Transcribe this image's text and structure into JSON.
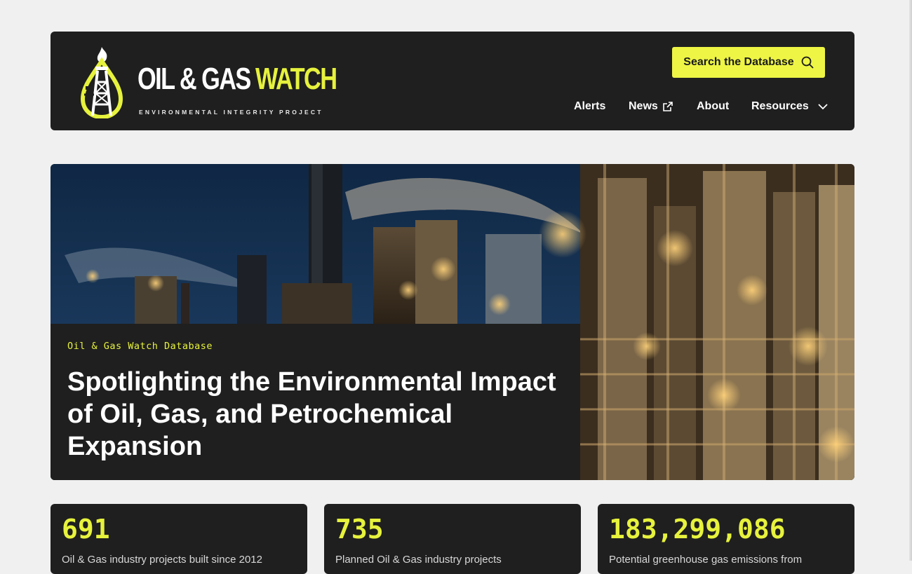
{
  "brand": {
    "name_main": "OIL & GAS",
    "name_accent": "WATCH",
    "tagline": "ENVIRONMENTAL INTEGRITY PROJECT",
    "colors": {
      "accent": "#e6f23c",
      "panel": "#1f1f1f",
      "background": "#f0f0f0"
    }
  },
  "header": {
    "search_button": {
      "label": "Search the Database",
      "icon": "search-icon"
    },
    "nav": [
      {
        "label": "Alerts"
      },
      {
        "label": "News",
        "icon": "external-link-icon"
      },
      {
        "label": "About"
      },
      {
        "label": "Resources",
        "icon": "chevron-down-icon"
      }
    ]
  },
  "hero": {
    "eyebrow": "Oil & Gas Watch Database",
    "title": "Spotlighting the Environmental Impact of Oil, Gas, and Petrochemical Expansion"
  },
  "stats": [
    {
      "value": "691",
      "label": "Oil & Gas industry projects built since 2012"
    },
    {
      "value": "735",
      "label": "Planned Oil & Gas industry projects"
    },
    {
      "value": "183,299,086",
      "label": "Potential greenhouse gas emissions from"
    }
  ]
}
